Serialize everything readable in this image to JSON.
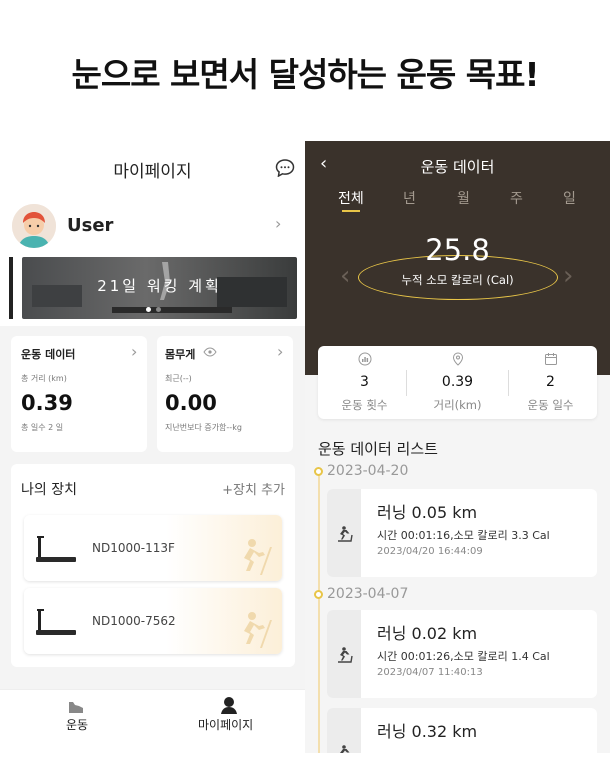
{
  "headline": "눈으로 보면서 달성하는 운동 목표!",
  "left": {
    "title": "마이페이지",
    "user_name": "User",
    "banner_text": "21일 워킹 계획",
    "exercise_card": {
      "title": "운동 데이터",
      "distance_label": "총 거리 (km)",
      "distance_value": "0.39",
      "days_label": "총 일수 2 일"
    },
    "weight_card": {
      "title": "몸무게",
      "recent_label": "최근(--)",
      "value": "0.00",
      "diff_label": "지난번보다 증가함--kg"
    },
    "devices": {
      "title": "나의 장치",
      "add_label": "+장치 추가",
      "items": [
        {
          "name": "ND1000-113F"
        },
        {
          "name": "ND1000-7562"
        }
      ]
    },
    "tabbar": {
      "tab1": "운동",
      "tab2": "마이페이지"
    }
  },
  "right": {
    "title": "운동 데이터",
    "tabs": [
      "전체",
      "년",
      "월",
      "주",
      "일"
    ],
    "active_tab": "전체",
    "total_value": "25.8",
    "total_label": "누적 소모 칼로리 (Cal)",
    "stats": [
      {
        "value": "3",
        "label": "운동 횟수",
        "icon": "chart-icon"
      },
      {
        "value": "0.39",
        "label": "거리(km)",
        "icon": "location-pin-icon"
      },
      {
        "value": "2",
        "label": "운동 일수",
        "icon": "calendar-icon"
      }
    ],
    "list_title": "운동 데이터 리스트",
    "dates": [
      "2023-04-20",
      "2023-04-07"
    ],
    "entries": [
      {
        "title": "러닝 0.05 km",
        "detail": "시간 00:01:16,소모 칼로리 3.3 Cal",
        "timestamp": "2023/04/20 16:44:09"
      },
      {
        "title": "러닝 0.02 km",
        "detail": "시간 00:01:26,소모 칼로리 1.4 Cal",
        "timestamp": "2023/04/07 11:40:13"
      },
      {
        "title": "러닝 0.32 km",
        "detail": "",
        "timestamp": ""
      }
    ]
  },
  "colors": {
    "accent": "#e8c548",
    "dark_header": "#3a322b"
  }
}
